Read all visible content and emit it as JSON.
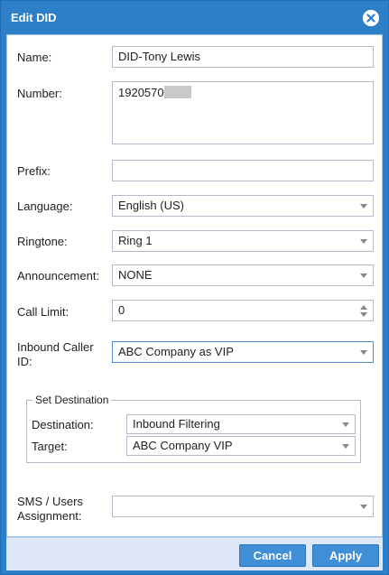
{
  "dialog": {
    "title": "Edit DID",
    "close_icon": "close-circle-icon",
    "accent_color": "#2d80c7"
  },
  "form": {
    "name": {
      "label": "Name:",
      "value": "DID-Tony Lewis"
    },
    "number": {
      "label": "Number:",
      "value": "1920570"
    },
    "prefix": {
      "label": "Prefix:",
      "value": ""
    },
    "language": {
      "label": "Language:",
      "value": "English (US)"
    },
    "ringtone": {
      "label": "Ringtone:",
      "value": "Ring 1"
    },
    "announcement": {
      "label": "Announcement:",
      "value": "NONE"
    },
    "call_limit": {
      "label": "Call Limit:",
      "value": "0"
    },
    "inbound_caller_id": {
      "label_line1": "Inbound Caller",
      "label_line2": "ID:",
      "value": "ABC Company as VIP"
    },
    "set_destination": {
      "legend": "Set Destination",
      "destination": {
        "label": "Destination:",
        "value": "Inbound Filtering"
      },
      "target": {
        "label": "Target:",
        "value": "ABC Company VIP"
      }
    },
    "sms_users": {
      "label_line1": "SMS / Users",
      "label_line2": "Assignment:",
      "value": ""
    }
  },
  "footer": {
    "cancel_label": "Cancel",
    "apply_label": "Apply"
  }
}
